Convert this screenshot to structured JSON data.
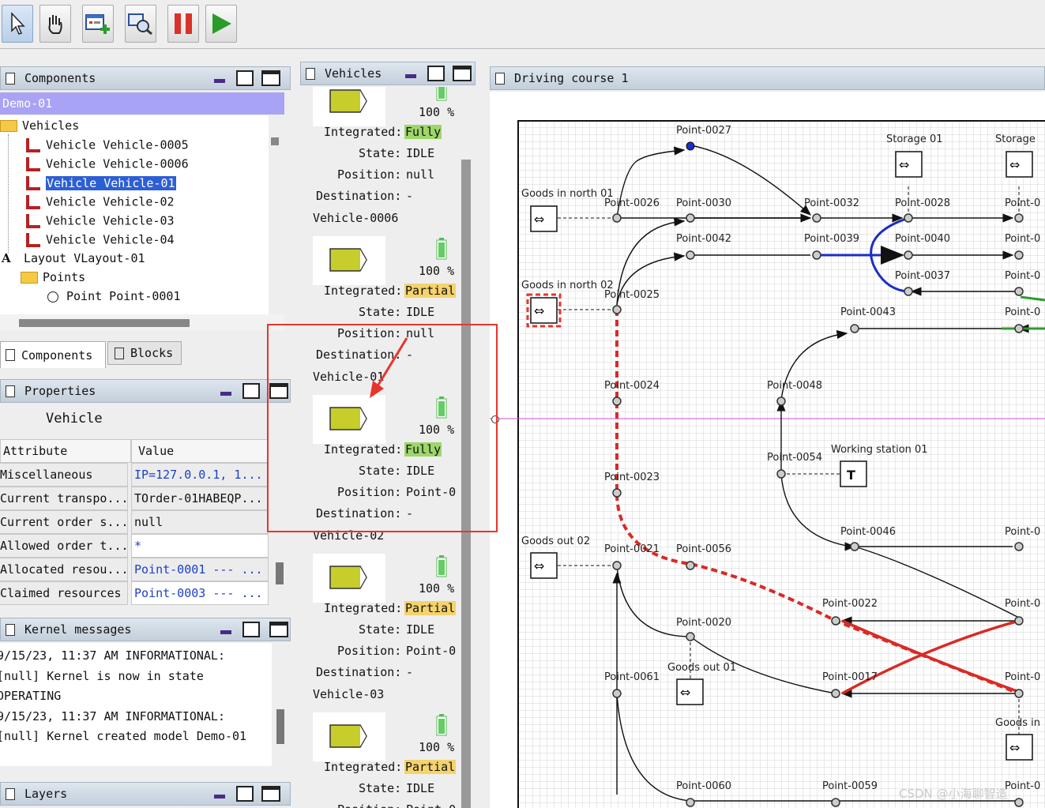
{
  "toolbar": {
    "buttons": [
      {
        "name": "select-tool-button",
        "icon": "cursor-arrow-icon"
      },
      {
        "name": "pan-tool-button",
        "icon": "hand-icon"
      },
      {
        "name": "create-order-button",
        "icon": "window-add-icon"
      },
      {
        "name": "find-vehicle-button",
        "icon": "magnifier-vehicle-icon"
      },
      {
        "name": "pause-button",
        "icon": "pause-icon"
      },
      {
        "name": "play-button",
        "icon": "play-icon"
      }
    ]
  },
  "components_panel": {
    "title": "Components",
    "model_name": "Demo-01",
    "tree": [
      {
        "label": "Vehicles",
        "type": "folder"
      },
      {
        "label": "Vehicle Vehicle-0005",
        "type": "vehicle"
      },
      {
        "label": "Vehicle Vehicle-0006",
        "type": "vehicle"
      },
      {
        "label": "Vehicle Vehicle-01",
        "type": "vehicle",
        "selected": true
      },
      {
        "label": "Vehicle Vehicle-02",
        "type": "vehicle"
      },
      {
        "label": "Vehicle Vehicle-03",
        "type": "vehicle"
      },
      {
        "label": "Vehicle Vehicle-04",
        "type": "vehicle"
      },
      {
        "label": "Layout VLayout-01",
        "type": "layout"
      },
      {
        "label": "Points",
        "type": "folder"
      },
      {
        "label": "Point Point-0001",
        "type": "point"
      }
    ],
    "tabs": [
      "Components",
      "Blocks"
    ]
  },
  "properties_panel": {
    "title": "Properties",
    "subtitle": "Vehicle",
    "headers": [
      "Attribute",
      "Value"
    ],
    "rows": [
      {
        "attr": "Miscellaneous",
        "value": "IP=127.0.0.1, 1...",
        "link": true
      },
      {
        "attr": "Current transpo...",
        "value": "TOrder-01HABEQP...",
        "link": false
      },
      {
        "attr": "Current order s...",
        "value": "null",
        "link": false
      },
      {
        "attr": "Allowed order t...",
        "value": "*",
        "link": true
      },
      {
        "attr": "Allocated resou...",
        "value": "Point-0001 --- ...",
        "link": true
      },
      {
        "attr": "Claimed resources",
        "value": "Point-0003 --- ...",
        "link": true
      }
    ]
  },
  "kernel_panel": {
    "title": "Kernel messages",
    "lines": [
      "9/15/23, 11:37 AM INFORMATIONAL:",
      "[null] Kernel is now in state",
      "OPERATING",
      "9/15/23, 11:37 AM INFORMATIONAL:",
      "[null] Kernel created model Demo-01"
    ]
  },
  "layers_panel": {
    "title": "Layers"
  },
  "vehicles_panel": {
    "title": "Vehicles",
    "labels": {
      "integrated": "Integrated:",
      "state": "State:",
      "position": "Position:",
      "destination": "Destination:"
    },
    "vehicles": [
      {
        "name": "",
        "energy": "100 %",
        "integrated": "Fully",
        "state": "IDLE",
        "position": "null",
        "destination": "-"
      },
      {
        "name": "Vehicle-0006",
        "energy": "100 %",
        "integrated": "Partial",
        "state": "IDLE",
        "position": "null",
        "destination": "-"
      },
      {
        "name": "Vehicle-01",
        "energy": "100 %",
        "integrated": "Fully",
        "state": "IDLE",
        "position": "Point-0",
        "destination": "-"
      },
      {
        "name": "Vehicle-02",
        "energy": "100 %",
        "integrated": "Partial",
        "state": "IDLE",
        "position": "Point-0",
        "destination": "-"
      },
      {
        "name": "Vehicle-03",
        "energy": "100 %",
        "integrated": "Partial",
        "state": "IDLE",
        "position": "Point-0",
        "destination": ""
      }
    ]
  },
  "driving_course": {
    "title": "Driving course 1",
    "points": [
      "Point-0027",
      "Point-0026",
      "Point-0030",
      "Point-0032",
      "Point-0028",
      "Point-0042",
      "Point-0039",
      "Point-0040",
      "Point-0037",
      "Point-0025",
      "Point-0043",
      "Point-0024",
      "Point-0048",
      "Point-0054",
      "Point-0023",
      "Point-0046",
      "Point-0021",
      "Point-0056",
      "Point-0022",
      "Point-0020",
      "Point-0061",
      "Point-0017",
      "Point-0060",
      "Point-0059"
    ],
    "stations": [
      "Storage 01",
      "Goods in north 01",
      "Goods in north 02",
      "Working station 01",
      "Goods out 02",
      "Goods out 01",
      "Goods in"
    ],
    "clipped_labels": [
      "Storage",
      "Point-0",
      "Point-0",
      "Point-0",
      "Point-0",
      "Point-0",
      "Point-0",
      "Point-0",
      "Point-0",
      "Point-0"
    ]
  },
  "watermark": "CSDN @小海聊智造",
  "colors": {
    "selection": "#2d5fd4",
    "model_bar": "#a9a3f5",
    "annotation": "#e8352b",
    "route": "#d92a25",
    "blue_path": "#1a2ec4"
  }
}
